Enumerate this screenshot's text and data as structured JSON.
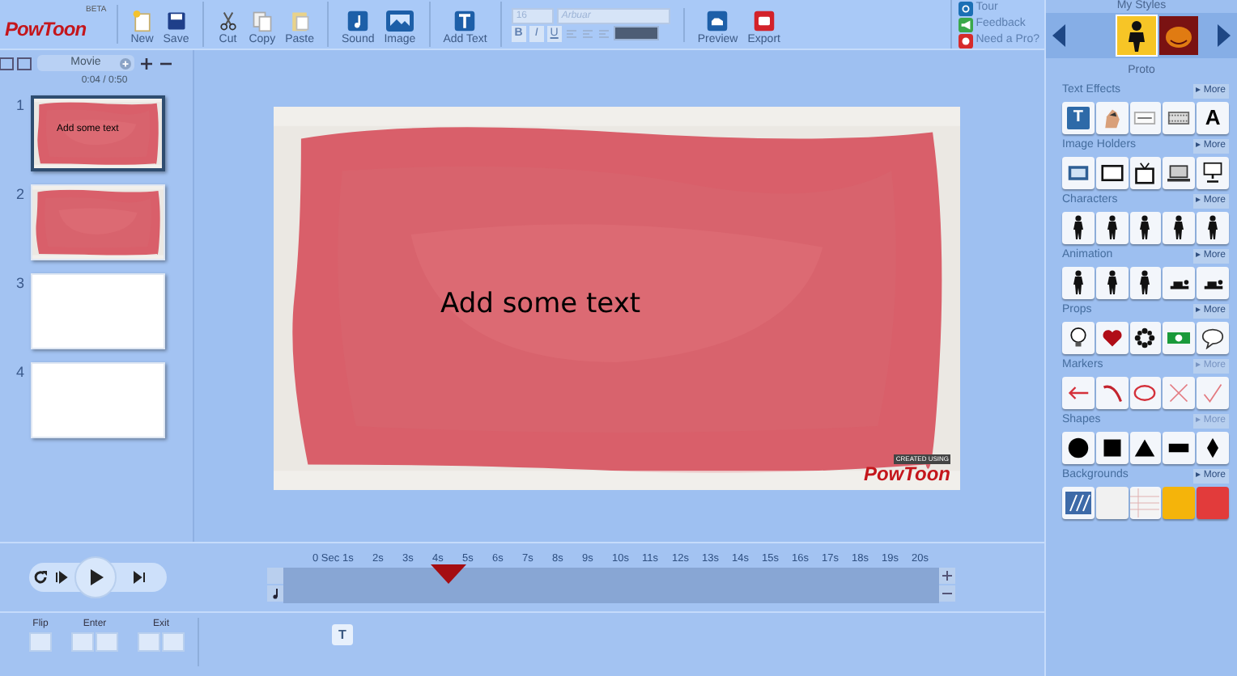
{
  "logo": {
    "text": "PowToon",
    "badge": "BETA"
  },
  "toolbar_groups": [
    [
      {
        "label": "New"
      },
      {
        "label": "Save"
      }
    ],
    [
      {
        "label": "Cut"
      },
      {
        "label": "Copy"
      },
      {
        "label": "Paste"
      }
    ],
    [
      {
        "label": "Sound"
      },
      {
        "label": "Image"
      }
    ],
    [
      {
        "label": "Add Text"
      }
    ]
  ],
  "text_format": {
    "disabled": true,
    "size": "16",
    "font": "Arbuar",
    "styles": [
      "B",
      "I",
      "U"
    ]
  },
  "publish": [
    {
      "label": "Preview"
    },
    {
      "label": "Export"
    }
  ],
  "help_links": [
    {
      "label": "Tour"
    },
    {
      "label": "Feedback"
    },
    {
      "label": "Need a Pro?"
    }
  ],
  "my_styles": {
    "title": "My Styles",
    "styles": [
      {
        "selected": true
      },
      {
        "selected": false
      }
    ],
    "caption": "Proto"
  },
  "categories": [
    {
      "title": "Text Effects",
      "more": "▸ More",
      "more_disabled": false,
      "items": [
        {
          "kind": "glyph",
          "text": "T"
        },
        {
          "kind": "hand"
        },
        {
          "kind": "video"
        },
        {
          "kind": "film"
        },
        {
          "kind": "letter",
          "text": "A"
        }
      ]
    },
    {
      "title": "Image Holders",
      "more": "▸ More",
      "more_disabled": false,
      "items": [
        {
          "kind": "picture-frame"
        },
        {
          "kind": "monitor"
        },
        {
          "kind": "tv"
        },
        {
          "kind": "laptop"
        },
        {
          "kind": "screen-stand"
        }
      ]
    },
    {
      "title": "Characters",
      "more": "▸ More",
      "more_disabled": false,
      "items": [
        {
          "kind": "figure"
        },
        {
          "kind": "figure"
        },
        {
          "kind": "figure"
        },
        {
          "kind": "figure"
        },
        {
          "kind": "figure"
        }
      ]
    },
    {
      "title": "Animation",
      "more": "▸ More",
      "more_disabled": false,
      "items": [
        {
          "kind": "figure"
        },
        {
          "kind": "figure"
        },
        {
          "kind": "figure"
        },
        {
          "kind": "figure-lying"
        },
        {
          "kind": "figure-lying"
        }
      ]
    },
    {
      "title": "Props",
      "more": "▸ More",
      "more_disabled": false,
      "items": [
        {
          "kind": "bulb"
        },
        {
          "kind": "heart"
        },
        {
          "kind": "flower"
        },
        {
          "kind": "money"
        },
        {
          "kind": "bubble"
        }
      ]
    },
    {
      "title": "Markers",
      "more": "▸ More",
      "more_disabled": true,
      "items": [
        {
          "kind": "arrow"
        },
        {
          "kind": "curve"
        },
        {
          "kind": "ellipse"
        },
        {
          "kind": "cross"
        },
        {
          "kind": "check"
        }
      ]
    },
    {
      "title": "Shapes",
      "more": "▸ More",
      "more_disabled": true,
      "items": [
        {
          "kind": "circle"
        },
        {
          "kind": "square"
        },
        {
          "kind": "triangle"
        },
        {
          "kind": "bar"
        },
        {
          "kind": "diamond"
        }
      ]
    },
    {
      "title": "Backgrounds",
      "more": "▸ More",
      "more_disabled": false,
      "items": [
        {
          "kind": "stripes"
        },
        {
          "kind": "blank"
        },
        {
          "kind": "lined"
        },
        {
          "kind": "swatch",
          "color": "#f5b40a"
        },
        {
          "kind": "swatch",
          "color": "#e23b3b"
        }
      ]
    }
  ],
  "slides_panel": {
    "tab": "Movie",
    "time": "0:04 / 0:50",
    "slides": [
      {
        "number": "1",
        "kind": "red",
        "text": "Add some text",
        "selected": true
      },
      {
        "number": "2",
        "kind": "red",
        "selected": false
      },
      {
        "number": "3",
        "kind": "blank",
        "selected": false
      },
      {
        "number": "4",
        "kind": "blank",
        "selected": false
      }
    ]
  },
  "stage": {
    "text": "Add some text",
    "stamp_caption": "CREATED USING",
    "stamp_logo": "PowToon"
  },
  "timeline": {
    "ticks": [
      "0 Sec",
      "1s",
      "2s",
      "3s",
      "4s",
      "5s",
      "6s",
      "7s",
      "8s",
      "9s",
      "10s",
      "11s",
      "12s",
      "13s",
      "14s",
      "15s",
      "16s",
      "17s",
      "18s",
      "19s",
      "20s"
    ],
    "level": 0.22
  },
  "bottom": {
    "flip": "Flip",
    "enter": "Enter",
    "exit": "Exit",
    "text_button": "T"
  }
}
